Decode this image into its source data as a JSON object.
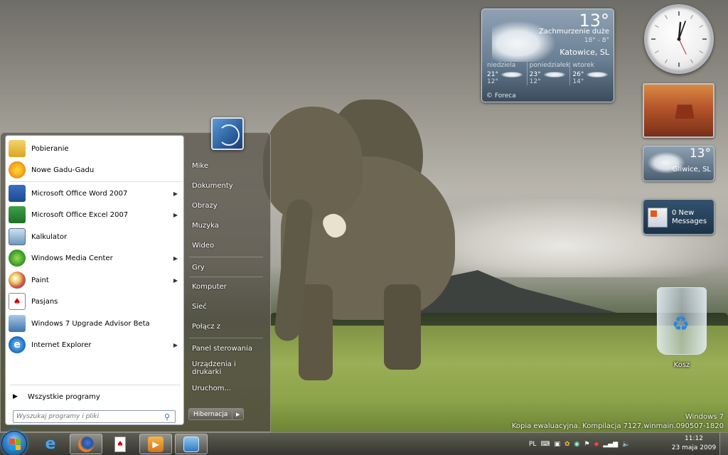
{
  "wallpaper": {
    "watermark_line1": "Windows 7",
    "watermark_line2": "Kopia ewaluacyjna. Kompilacja 7127.winmain.090507-1820"
  },
  "weather_gadget": {
    "temperature": "13°",
    "condition": "Zachmurzenie duże",
    "range": "18° - 8°",
    "city": "Katowice, SL",
    "forecast": [
      {
        "day": "niedziela",
        "high": "21°",
        "low": "12°"
      },
      {
        "day": "poniedziałek",
        "high": "23°",
        "low": "12°"
      },
      {
        "day": "wtorek",
        "high": "26°",
        "low": "14°"
      }
    ],
    "provider": "© Foreca"
  },
  "weather_small": {
    "temperature": "13°",
    "city": "Gliwice, SL"
  },
  "messages_gadget": {
    "line1": "0 New",
    "line2": "Messages"
  },
  "desktop": {
    "recycle_bin_label": "Kosz"
  },
  "start_menu": {
    "programs": [
      {
        "label": "Pobieranie",
        "icon": "folder-download-icon",
        "submenu": false
      },
      {
        "label": "Nowe Gadu-Gadu",
        "icon": "gadu-gadu-sun-icon",
        "submenu": false
      },
      {
        "label": "Microsoft Office Word 2007",
        "icon": "word-icon",
        "submenu": true
      },
      {
        "label": "Microsoft Office Excel 2007",
        "icon": "excel-icon",
        "submenu": true
      },
      {
        "label": "Kalkulator",
        "icon": "calculator-icon",
        "submenu": false
      },
      {
        "label": "Windows Media Center",
        "icon": "media-center-icon",
        "submenu": true
      },
      {
        "label": "Paint",
        "icon": "paint-icon",
        "submenu": true
      },
      {
        "label": "Pasjans",
        "icon": "solitaire-icon",
        "submenu": false
      },
      {
        "label": "Windows 7 Upgrade Advisor Beta",
        "icon": "upgrade-advisor-icon",
        "submenu": false
      },
      {
        "label": "Internet Explorer",
        "icon": "internet-explorer-icon",
        "submenu": true
      }
    ],
    "all_programs": "Wszystkie programy",
    "search_placeholder": "Wyszukaj programy i pliki",
    "right_items": [
      "Mike",
      "Dokumenty",
      "Obrazy",
      "Muzyka",
      "Wideo",
      "Gry",
      "Komputer",
      "Sieć",
      "Połącz z",
      "Panel sterowania",
      "Urządzenia i drukarki",
      "Uruchom..."
    ],
    "shutdown_label": "Hibernacja"
  },
  "taskbar": {
    "apps": [
      "internet-explorer-icon",
      "firefox-icon",
      "solitaire-icon",
      "media-player-icon",
      "capture-icon"
    ],
    "language": "PL",
    "time": "11:12",
    "date": "23 maja 2009"
  },
  "colors": {
    "start_menu_left_bg": "#ffffff",
    "accent_blue": "#3a86d0"
  }
}
